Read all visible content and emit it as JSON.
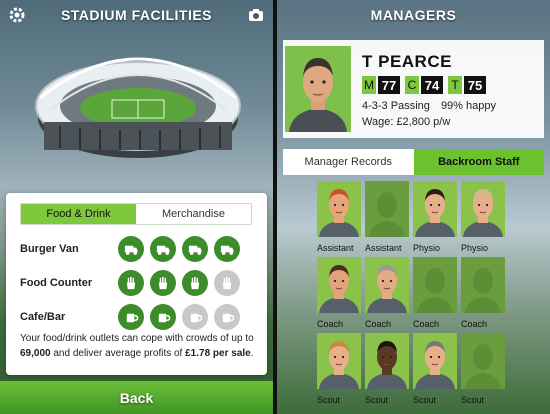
{
  "left": {
    "title": "STADIUM FACILITIES",
    "tabs": [
      {
        "label": "Food & Drink",
        "active": true
      },
      {
        "label": "Merchandise",
        "active": false
      }
    ],
    "facilities": [
      {
        "label": "Burger Van",
        "icon": "van-icon",
        "active": [
          true,
          true,
          true,
          true
        ]
      },
      {
        "label": "Food Counter",
        "icon": "fries-icon",
        "active": [
          true,
          true,
          true,
          false
        ]
      },
      {
        "label": "Cafe/Bar",
        "icon": "mug-icon",
        "active": [
          true,
          true,
          false,
          false
        ]
      }
    ],
    "summary": {
      "prefix": "Your food/drink outlets can cope with crowds of up to ",
      "crowd": "69,000",
      "middle": " and deliver average profits of ",
      "profit": "£1.78 per sale",
      "suffix": "."
    },
    "back_label": "Back"
  },
  "right": {
    "title": "MANAGERS",
    "manager": {
      "name": "T PEARCE",
      "ratings": [
        {
          "key": "M",
          "value": "77"
        },
        {
          "key": "C",
          "value": "74"
        },
        {
          "key": "T",
          "value": "75"
        }
      ],
      "tactics": "4-3-3 Passing",
      "happiness": "99% happy",
      "wage": "Wage: £2,800 p/w"
    },
    "tabs": [
      {
        "label": "Manager Records",
        "active": false
      },
      {
        "label": "Backroom Staff",
        "active": true
      }
    ],
    "staff": [
      {
        "role": "Assistant",
        "filled": true,
        "hair": "#c8532a",
        "skin": "#e8a57a"
      },
      {
        "role": "Assistant",
        "filled": false
      },
      {
        "role": "Physio",
        "filled": true,
        "hair": "#2a1d17",
        "skin": "#e8b08a"
      },
      {
        "role": "Physio",
        "filled": true,
        "hair": "#d9b58c",
        "skin": "#e8b08a"
      },
      {
        "role": "Coach",
        "filled": true,
        "hair": "#4a2d1c",
        "skin": "#e3a37c"
      },
      {
        "role": "Coach",
        "filled": true,
        "hair": "#9a9a9a",
        "skin": "#e3aa86"
      },
      {
        "role": "Coach",
        "filled": false
      },
      {
        "role": "Coach",
        "filled": false
      },
      {
        "role": "Scout",
        "filled": true,
        "hair": "#c88a3a",
        "skin": "#e8b08a"
      },
      {
        "role": "Scout",
        "filled": true,
        "hair": "#1a1412",
        "skin": "#5a3826"
      },
      {
        "role": "Scout",
        "filled": true,
        "hair": "#7a7a7a",
        "skin": "#e8b08a"
      },
      {
        "role": "Scout",
        "filled": false
      }
    ]
  },
  "colors": {
    "accent_green": "#7dc83c",
    "dark_green": "#3c8c2a",
    "inactive_grey": "#c6c9c6"
  }
}
